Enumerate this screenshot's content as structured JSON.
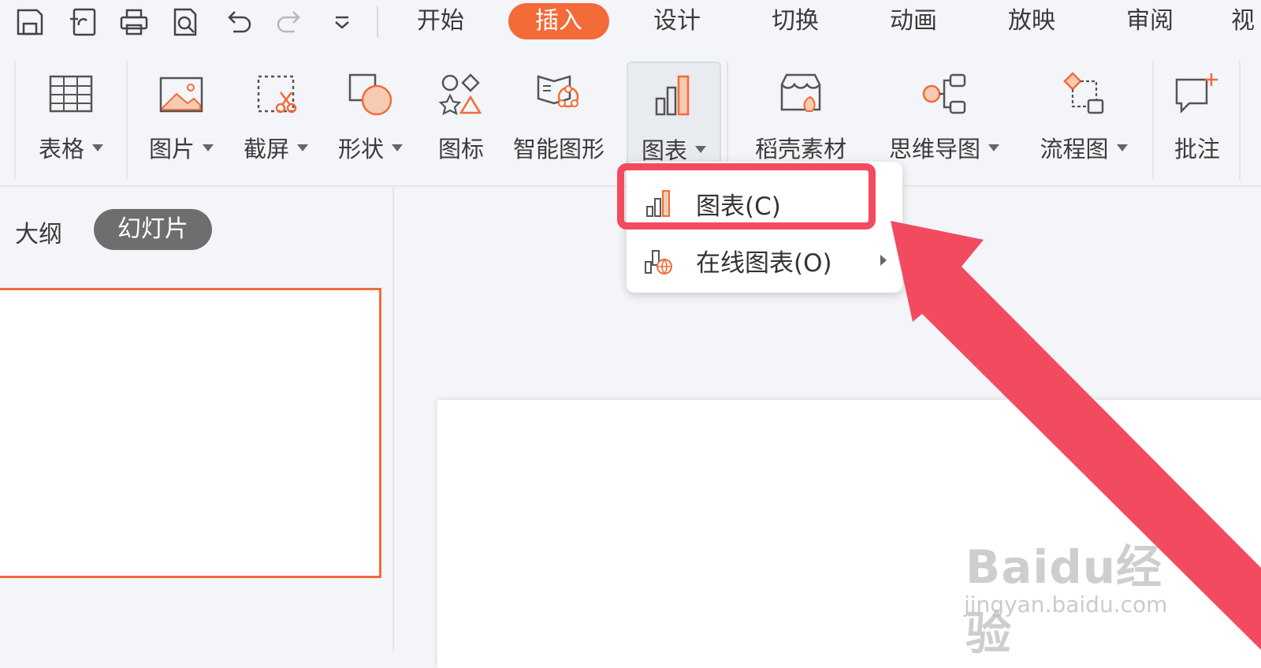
{
  "menu": {
    "tabs": [
      {
        "label": "开始"
      },
      {
        "label": "插入",
        "active": true
      },
      {
        "label": "设计"
      },
      {
        "label": "切换"
      },
      {
        "label": "动画"
      },
      {
        "label": "放映"
      },
      {
        "label": "审阅"
      },
      {
        "label": "视"
      }
    ]
  },
  "quick_access": [
    "save-icon",
    "share-icon",
    "print-icon",
    "print-preview-icon",
    "undo-icon",
    "redo-icon",
    "customize-dropdown-icon"
  ],
  "ribbon": {
    "table": "表格",
    "picture": "图片",
    "screenshot": "截屏",
    "shape": "形状",
    "icon": "图标",
    "smartart": "智能图形",
    "chart": "图表",
    "docer_assets": "稻壳素材",
    "mindmap": "思维导图",
    "flowchart": "流程图",
    "comment": "批注"
  },
  "left_panel": {
    "outline_tab": "大纲",
    "slides_tab": "幻灯片"
  },
  "chart_dropdown": {
    "items": [
      {
        "label": "图表(C)"
      },
      {
        "label": "在线图表(O)",
        "has_submenu": true
      }
    ]
  },
  "watermark": {
    "logo": "Baidu经验",
    "url": "jingyan.baidu.com"
  },
  "colors": {
    "accent": "#f26b38",
    "annotation": "#f24b60"
  }
}
